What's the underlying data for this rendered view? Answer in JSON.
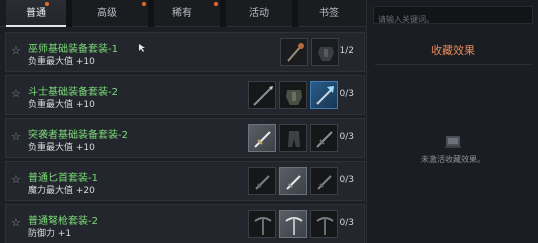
{
  "tabs": [
    {
      "label": "普通",
      "active": true
    },
    {
      "label": "高级",
      "active": false
    },
    {
      "label": "稀有",
      "active": false
    },
    {
      "label": "活动",
      "active": false
    },
    {
      "label": "书签",
      "active": false
    }
  ],
  "search": {
    "placeholder": "请输入关键词。"
  },
  "panel": {
    "title": "收藏效果",
    "empty_text": "未激活收藏效果。"
  },
  "collections": [
    {
      "name": "巫师基础装备套装-1",
      "stat": "负重最大值 +10",
      "count": "1/2",
      "slots": [
        "staff-icon",
        "armor-icon"
      ]
    },
    {
      "name": "斗士基础装备套装-2",
      "stat": "负重最大值 +10",
      "count": "0/3",
      "slots": [
        "spear-icon",
        "armor-icon",
        "axe-icon"
      ]
    },
    {
      "name": "突袭者基础装备套装-2",
      "stat": "负重最大值 +10",
      "count": "0/3",
      "slots": [
        "sword-icon",
        "armor-icon",
        "sword-icon"
      ]
    },
    {
      "name": "普通匕首套装-1",
      "stat": "魔力最大值 +20",
      "count": "0/3",
      "slots": [
        "dagger-icon",
        "dagger-icon",
        "dagger-icon"
      ]
    },
    {
      "name": "普通弩枪套装-2",
      "stat": "防御力 +1",
      "count": "0/3",
      "slots": [
        "crossbow-icon",
        "crossbow-icon",
        "crossbow-icon"
      ]
    }
  ],
  "colors": {
    "accent": "#e58a5e",
    "set_name": "#7ddc7a",
    "tab_dot": "#e26a2c"
  }
}
